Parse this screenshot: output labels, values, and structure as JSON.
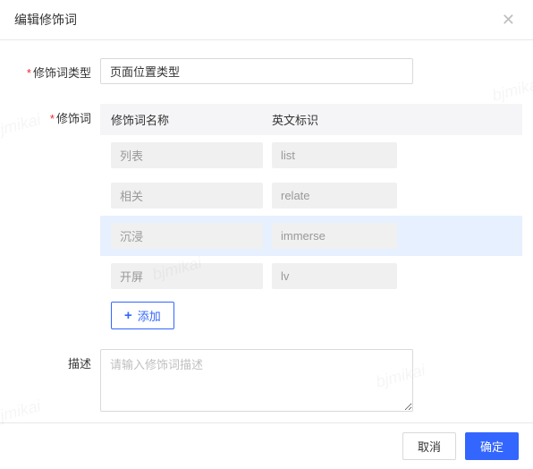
{
  "header": {
    "title": "编辑修饰词"
  },
  "form": {
    "type_label": "修饰词类型",
    "type_value": "页面位置类型",
    "modifier_label": "修饰词",
    "columns": {
      "name": "修饰词名称",
      "en": "英文标识"
    },
    "rows": [
      {
        "name": "列表",
        "en": "list",
        "highlight": false
      },
      {
        "name": "相关",
        "en": "relate",
        "highlight": false
      },
      {
        "name": "沉浸",
        "en": "immerse",
        "highlight": true
      },
      {
        "name": "开屏",
        "en": "lv",
        "highlight": false
      }
    ],
    "add_label": "添加",
    "desc_label": "描述",
    "desc_placeholder": "请输入修饰词描述"
  },
  "footer": {
    "cancel": "取消",
    "confirm": "确定"
  },
  "watermark": "bjmikai"
}
